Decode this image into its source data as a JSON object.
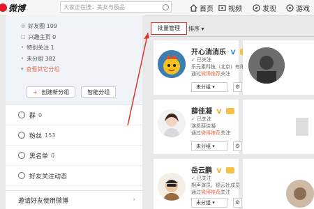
{
  "header": {
    "logo_text": "微博",
    "search_placeholder": "大家正在搜：美女与极品",
    "nav": [
      {
        "label": "首页",
        "icon": "home-icon"
      },
      {
        "label": "视频",
        "icon": "video-icon"
      },
      {
        "label": "发现",
        "icon": "discover-icon"
      },
      {
        "label": "游戏",
        "icon": "game-icon"
      }
    ]
  },
  "sidebar": {
    "groups": [
      {
        "label": "好友圈 109",
        "icon": "circle-icon"
      },
      {
        "label": "兴趣主页 0",
        "icon": "square-icon"
      },
      {
        "label": "特别关注 1",
        "icon": "dot-icon"
      },
      {
        "label": "未分组 382",
        "icon": "dot-icon"
      }
    ],
    "more_groups": "查看其它分组",
    "create_group": "创建新分组",
    "smart_group": "智能分组",
    "items": [
      {
        "label": "群",
        "count": "0",
        "icon": "group-icon"
      },
      {
        "label": "粉丝",
        "count": "153",
        "icon": "fans-icon"
      },
      {
        "label": "黑名单",
        "count": "0",
        "icon": "blacklist-icon"
      },
      {
        "label": "好友关注动态",
        "count": "",
        "icon": "activity-icon"
      }
    ],
    "invite": "邀请好友使用微博"
  },
  "main": {
    "batch_manage": "批量管理",
    "sort": "排序",
    "followed": "已关注",
    "group_select": "未分组",
    "cards": [
      {
        "name": "开心消消乐",
        "verify": "V",
        "desc": "乐元素科技（北京）有限公司",
        "via_prefix": "通过",
        "via_link": "微博推荐",
        "via_suffix": "关注"
      },
      {
        "name": "薛佳凝",
        "verify": "V",
        "desc": "演员薛佳凝",
        "via_prefix": "通过",
        "via_link": "微博推荐",
        "via_suffix": "关注"
      },
      {
        "name": "岳云鹏",
        "verify": "V",
        "desc": "相声演员，德云社成员",
        "via_prefix": "通过",
        "via_link": "微博推荐",
        "via_suffix": "关注"
      }
    ]
  },
  "colors": {
    "accent": "#eb7350",
    "highlight": "#d9352b",
    "verified_blue": "#2d8fd6",
    "verified_gold": "#f2a81c"
  }
}
